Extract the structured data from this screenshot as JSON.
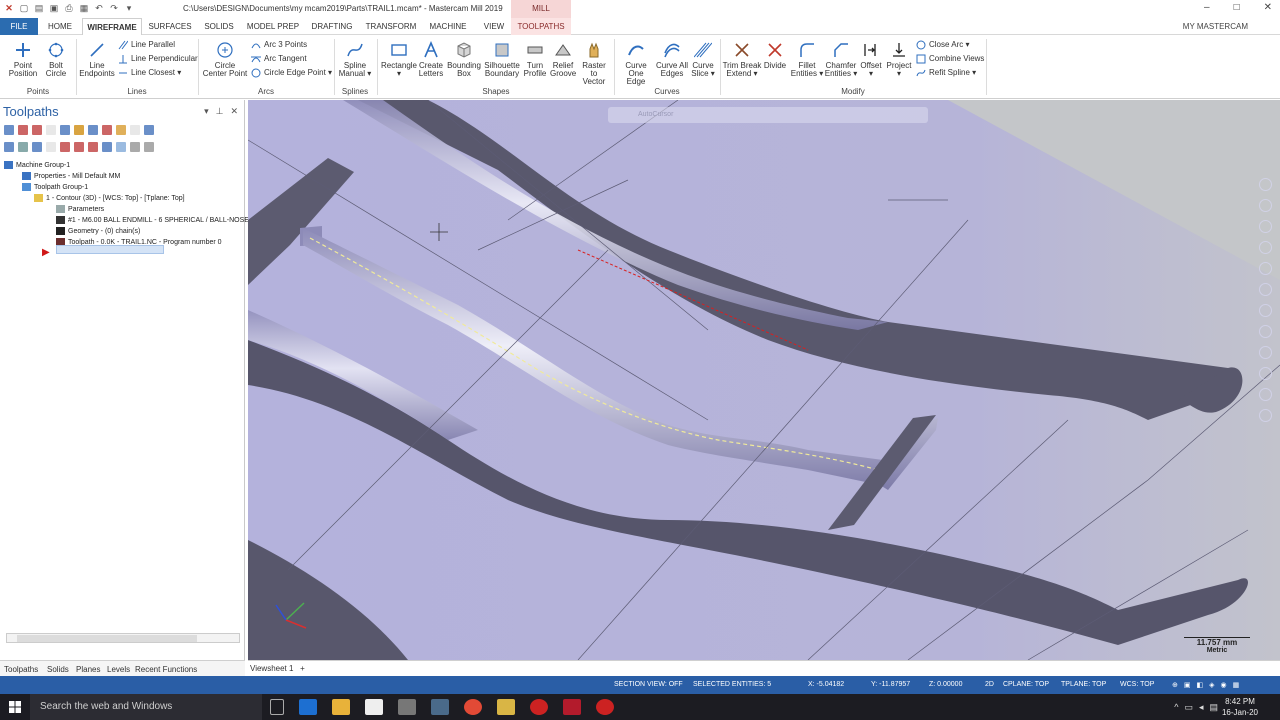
{
  "title_bar": {
    "path_title": "C:\\Users\\DESIGN\\Documents\\my mcam2019\\Parts\\TRAIL1.mcam* - Mastercam Mill 2019",
    "context_label": "MILL",
    "window_controls": [
      "–",
      "□",
      "✕"
    ]
  },
  "tabs": {
    "file": "FILE",
    "home": "HOME",
    "wireframe": "WIREFRAME",
    "surfaces": "SURFACES",
    "solids": "SOLIDS",
    "model_prep": "MODEL PREP",
    "drafting": "DRAFTING",
    "transform": "TRANSFORM",
    "machine": "MACHINE",
    "view": "VIEW",
    "toolpaths": "TOOLPATHS",
    "my_mastercam": "MY MASTERCAM"
  },
  "ribbon": {
    "points": {
      "group": "Points",
      "point_position": [
        "Point",
        "Position"
      ],
      "bolt_circle": [
        "Bolt",
        "Circle"
      ]
    },
    "lines": {
      "group": "Lines",
      "line_endpoints": [
        "Line",
        "Endpoints"
      ],
      "line_parallel": "Line Parallel",
      "line_perpendicular": "Line Perpendicular",
      "line_closest": "Line Closest"
    },
    "arcs": {
      "group": "Arcs",
      "circle_center_point": [
        "Circle",
        "Center Point"
      ],
      "arc_3_points": "Arc 3 Points",
      "arc_tangent": "Arc Tangent",
      "circle_edge_point": "Circle Edge Point"
    },
    "splines": {
      "group": "Splines",
      "spline_manual": [
        "Spline",
        "Manual"
      ]
    },
    "shapes": {
      "group": "Shapes",
      "rectangle": [
        "Rectangle",
        ""
      ],
      "create_letters": [
        "Create",
        "Letters"
      ],
      "bounding_box": [
        "Bounding",
        "Box"
      ],
      "silhouette_boundary": [
        "Silhouette",
        "Boundary"
      ],
      "turn_profile": [
        "Turn",
        "Profile"
      ],
      "relief_groove": [
        "Relief",
        "Groove"
      ],
      "raster_to_vector": [
        "Raster to",
        "Vector"
      ]
    },
    "curves": {
      "group": "Curves",
      "curve_one_edge": [
        "Curve",
        "One Edge"
      ],
      "curve_all_edges": [
        "Curve All",
        "Edges"
      ],
      "curve_slice": [
        "Curve",
        "Slice"
      ]
    },
    "modify": {
      "group": "Modify",
      "trim_break_extend": [
        "Trim Break",
        "Extend"
      ],
      "divide": [
        "Divide",
        ""
      ],
      "fillet_entities": [
        "Fillet",
        "Entities"
      ],
      "chamfer_entities": [
        "Chamfer",
        "Entities"
      ],
      "offset": [
        "Offset",
        ""
      ],
      "project": [
        "Project",
        ""
      ],
      "close_arc": "Close Arc",
      "combine_views": "Combine Views",
      "refit_spline": "Refit Spline"
    }
  },
  "toolpaths_panel": {
    "title": "Toolpaths",
    "tree": [
      "Machine Group-1",
      "Properties - Mill Default MM",
      "Toolpath Group-1",
      "1 - Contour (3D) - [WCS: Top] - [Tplane: Top]",
      "Parameters",
      "#1 - M6.00 BALL ENDMILL - 6 SPHERICAL / BALL-NOSE",
      "Geometry - (0) chain(s)",
      "Toolpath - 0.0K - TRAIL1.NC - Program number 0"
    ],
    "bottom_tabs": [
      "Toolpaths",
      "Solids",
      "Planes",
      "Levels",
      "Recent Functions"
    ]
  },
  "viewport": {
    "autocursor": "AutoCursor",
    "scale_value": "11.757 mm",
    "scale_unit": "Metric",
    "background": "#b7b5dc"
  },
  "sheet_bar": {
    "viewsheet": "Viewsheet 1",
    "add": "+"
  },
  "status_bar": {
    "section_view": "SECTION VIEW: OFF",
    "selected": "SELECTED ENTITIES: 5",
    "x": "X:   -5.04182",
    "y": "Y:   -11.87957",
    "z": "Z:   0.00000",
    "mode": "2D",
    "cplane": "CPLANE: TOP",
    "tplane": "TPLANE: TOP",
    "wcs": "WCS: TOP"
  },
  "taskbar": {
    "search": "Search the web and Windows",
    "time": "8:42 PM",
    "date": "16-Jan-20"
  }
}
